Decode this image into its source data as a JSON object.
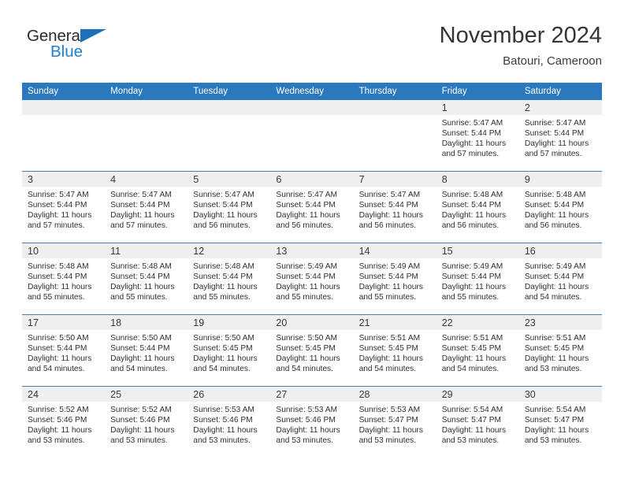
{
  "brand": {
    "name_part1": "General",
    "name_part2": "Blue",
    "triangle_color": "#1d71b8",
    "blue_color": "#1f7fd0",
    "dark_color": "#2b2b2b"
  },
  "header": {
    "month_title": "November 2024",
    "location": "Batouri, Cameroon"
  },
  "theme": {
    "header_bg": "#2a78bd",
    "daynum_bg": "#efefef",
    "row_border": "#4a7fae",
    "text": "#2f2f2f"
  },
  "weekdays": [
    "Sunday",
    "Monday",
    "Tuesday",
    "Wednesday",
    "Thursday",
    "Friday",
    "Saturday"
  ],
  "labels": {
    "sunrise_prefix": "Sunrise:",
    "sunset_prefix": "Sunset:",
    "daylight_prefix": "Daylight:"
  },
  "weeks": [
    [
      {
        "day": "",
        "empty": true
      },
      {
        "day": "",
        "empty": true
      },
      {
        "day": "",
        "empty": true
      },
      {
        "day": "",
        "empty": true
      },
      {
        "day": "",
        "empty": true
      },
      {
        "day": "1",
        "sunrise": "Sunrise: 5:47 AM",
        "sunset": "Sunset: 5:44 PM",
        "daylight_line1": "Daylight: 11 hours",
        "daylight_line2": "and 57 minutes."
      },
      {
        "day": "2",
        "sunrise": "Sunrise: 5:47 AM",
        "sunset": "Sunset: 5:44 PM",
        "daylight_line1": "Daylight: 11 hours",
        "daylight_line2": "and 57 minutes."
      }
    ],
    [
      {
        "day": "3",
        "sunrise": "Sunrise: 5:47 AM",
        "sunset": "Sunset: 5:44 PM",
        "daylight_line1": "Daylight: 11 hours",
        "daylight_line2": "and 57 minutes."
      },
      {
        "day": "4",
        "sunrise": "Sunrise: 5:47 AM",
        "sunset": "Sunset: 5:44 PM",
        "daylight_line1": "Daylight: 11 hours",
        "daylight_line2": "and 57 minutes."
      },
      {
        "day": "5",
        "sunrise": "Sunrise: 5:47 AM",
        "sunset": "Sunset: 5:44 PM",
        "daylight_line1": "Daylight: 11 hours",
        "daylight_line2": "and 56 minutes."
      },
      {
        "day": "6",
        "sunrise": "Sunrise: 5:47 AM",
        "sunset": "Sunset: 5:44 PM",
        "daylight_line1": "Daylight: 11 hours",
        "daylight_line2": "and 56 minutes."
      },
      {
        "day": "7",
        "sunrise": "Sunrise: 5:47 AM",
        "sunset": "Sunset: 5:44 PM",
        "daylight_line1": "Daylight: 11 hours",
        "daylight_line2": "and 56 minutes."
      },
      {
        "day": "8",
        "sunrise": "Sunrise: 5:48 AM",
        "sunset": "Sunset: 5:44 PM",
        "daylight_line1": "Daylight: 11 hours",
        "daylight_line2": "and 56 minutes."
      },
      {
        "day": "9",
        "sunrise": "Sunrise: 5:48 AM",
        "sunset": "Sunset: 5:44 PM",
        "daylight_line1": "Daylight: 11 hours",
        "daylight_line2": "and 56 minutes."
      }
    ],
    [
      {
        "day": "10",
        "sunrise": "Sunrise: 5:48 AM",
        "sunset": "Sunset: 5:44 PM",
        "daylight_line1": "Daylight: 11 hours",
        "daylight_line2": "and 55 minutes."
      },
      {
        "day": "11",
        "sunrise": "Sunrise: 5:48 AM",
        "sunset": "Sunset: 5:44 PM",
        "daylight_line1": "Daylight: 11 hours",
        "daylight_line2": "and 55 minutes."
      },
      {
        "day": "12",
        "sunrise": "Sunrise: 5:48 AM",
        "sunset": "Sunset: 5:44 PM",
        "daylight_line1": "Daylight: 11 hours",
        "daylight_line2": "and 55 minutes."
      },
      {
        "day": "13",
        "sunrise": "Sunrise: 5:49 AM",
        "sunset": "Sunset: 5:44 PM",
        "daylight_line1": "Daylight: 11 hours",
        "daylight_line2": "and 55 minutes."
      },
      {
        "day": "14",
        "sunrise": "Sunrise: 5:49 AM",
        "sunset": "Sunset: 5:44 PM",
        "daylight_line1": "Daylight: 11 hours",
        "daylight_line2": "and 55 minutes."
      },
      {
        "day": "15",
        "sunrise": "Sunrise: 5:49 AM",
        "sunset": "Sunset: 5:44 PM",
        "daylight_line1": "Daylight: 11 hours",
        "daylight_line2": "and 55 minutes."
      },
      {
        "day": "16",
        "sunrise": "Sunrise: 5:49 AM",
        "sunset": "Sunset: 5:44 PM",
        "daylight_line1": "Daylight: 11 hours",
        "daylight_line2": "and 54 minutes."
      }
    ],
    [
      {
        "day": "17",
        "sunrise": "Sunrise: 5:50 AM",
        "sunset": "Sunset: 5:44 PM",
        "daylight_line1": "Daylight: 11 hours",
        "daylight_line2": "and 54 minutes."
      },
      {
        "day": "18",
        "sunrise": "Sunrise: 5:50 AM",
        "sunset": "Sunset: 5:44 PM",
        "daylight_line1": "Daylight: 11 hours",
        "daylight_line2": "and 54 minutes."
      },
      {
        "day": "19",
        "sunrise": "Sunrise: 5:50 AM",
        "sunset": "Sunset: 5:45 PM",
        "daylight_line1": "Daylight: 11 hours",
        "daylight_line2": "and 54 minutes."
      },
      {
        "day": "20",
        "sunrise": "Sunrise: 5:50 AM",
        "sunset": "Sunset: 5:45 PM",
        "daylight_line1": "Daylight: 11 hours",
        "daylight_line2": "and 54 minutes."
      },
      {
        "day": "21",
        "sunrise": "Sunrise: 5:51 AM",
        "sunset": "Sunset: 5:45 PM",
        "daylight_line1": "Daylight: 11 hours",
        "daylight_line2": "and 54 minutes."
      },
      {
        "day": "22",
        "sunrise": "Sunrise: 5:51 AM",
        "sunset": "Sunset: 5:45 PM",
        "daylight_line1": "Daylight: 11 hours",
        "daylight_line2": "and 54 minutes."
      },
      {
        "day": "23",
        "sunrise": "Sunrise: 5:51 AM",
        "sunset": "Sunset: 5:45 PM",
        "daylight_line1": "Daylight: 11 hours",
        "daylight_line2": "and 53 minutes."
      }
    ],
    [
      {
        "day": "24",
        "sunrise": "Sunrise: 5:52 AM",
        "sunset": "Sunset: 5:46 PM",
        "daylight_line1": "Daylight: 11 hours",
        "daylight_line2": "and 53 minutes."
      },
      {
        "day": "25",
        "sunrise": "Sunrise: 5:52 AM",
        "sunset": "Sunset: 5:46 PM",
        "daylight_line1": "Daylight: 11 hours",
        "daylight_line2": "and 53 minutes."
      },
      {
        "day": "26",
        "sunrise": "Sunrise: 5:53 AM",
        "sunset": "Sunset: 5:46 PM",
        "daylight_line1": "Daylight: 11 hours",
        "daylight_line2": "and 53 minutes."
      },
      {
        "day": "27",
        "sunrise": "Sunrise: 5:53 AM",
        "sunset": "Sunset: 5:46 PM",
        "daylight_line1": "Daylight: 11 hours",
        "daylight_line2": "and 53 minutes."
      },
      {
        "day": "28",
        "sunrise": "Sunrise: 5:53 AM",
        "sunset": "Sunset: 5:47 PM",
        "daylight_line1": "Daylight: 11 hours",
        "daylight_line2": "and 53 minutes."
      },
      {
        "day": "29",
        "sunrise": "Sunrise: 5:54 AM",
        "sunset": "Sunset: 5:47 PM",
        "daylight_line1": "Daylight: 11 hours",
        "daylight_line2": "and 53 minutes."
      },
      {
        "day": "30",
        "sunrise": "Sunrise: 5:54 AM",
        "sunset": "Sunset: 5:47 PM",
        "daylight_line1": "Daylight: 11 hours",
        "daylight_line2": "and 53 minutes."
      }
    ]
  ]
}
